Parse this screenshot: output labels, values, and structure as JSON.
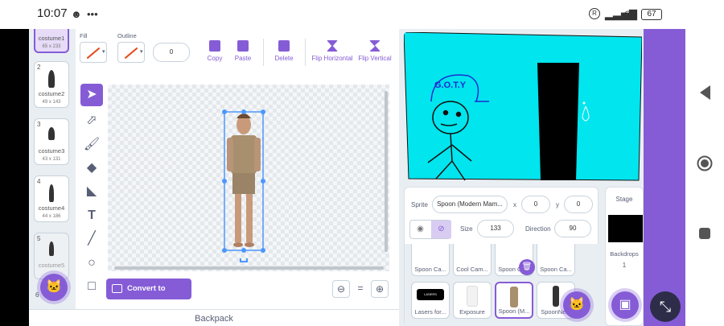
{
  "status": {
    "time": "10:07",
    "battery": "67"
  },
  "costumes": [
    {
      "num": "1",
      "name": "costume1",
      "size": "65 x 233"
    },
    {
      "num": "2",
      "name": "costume2",
      "size": "49 x 143"
    },
    {
      "num": "3",
      "name": "costume3",
      "size": "43 x 131"
    },
    {
      "num": "4",
      "name": "costume4",
      "size": "44 x 186"
    },
    {
      "num": "5",
      "name": "costume5",
      "size": ""
    },
    {
      "num": "6",
      "name": "",
      "size": ""
    }
  ],
  "toolbar": {
    "fill_label": "Fill",
    "outline_label": "Outline",
    "outline_width": "0",
    "copy": "Copy",
    "paste": "Paste",
    "delete": "Delete",
    "flip_h": "Flip Horizontal",
    "flip_v": "Flip Vertical"
  },
  "convert_bitmap": "Convert to Bitmap",
  "zoom_reset": "=",
  "backpack": "Backpack",
  "stage_drawing": {
    "cap_text": "G.O.T.Y"
  },
  "sprite_info": {
    "sprite_label": "Sprite",
    "sprite_name": "Spoon (Modern Mam...",
    "x_label": "x",
    "x_value": "0",
    "y_label": "y",
    "y_value": "0",
    "size_label": "Size",
    "size_value": "133",
    "direction_label": "Direction",
    "direction_value": "90"
  },
  "sprites_row1": [
    "Spoon Ca...",
    "Cool Cam...",
    "Spoon Ca...",
    "Spoon Ca..."
  ],
  "sprites_row2": [
    "Lasers for...",
    "Exposure",
    "Spoon (M...",
    "SpoonNe..."
  ],
  "laser_thumb_text": "LASERS",
  "stage_target": {
    "label": "Stage",
    "backdrops_label": "Backdrops",
    "backdrops_count": "1"
  },
  "colors": {
    "accent": "#855cd6",
    "stage_bg": "#00e5ee",
    "selection": "#4c97ff"
  }
}
